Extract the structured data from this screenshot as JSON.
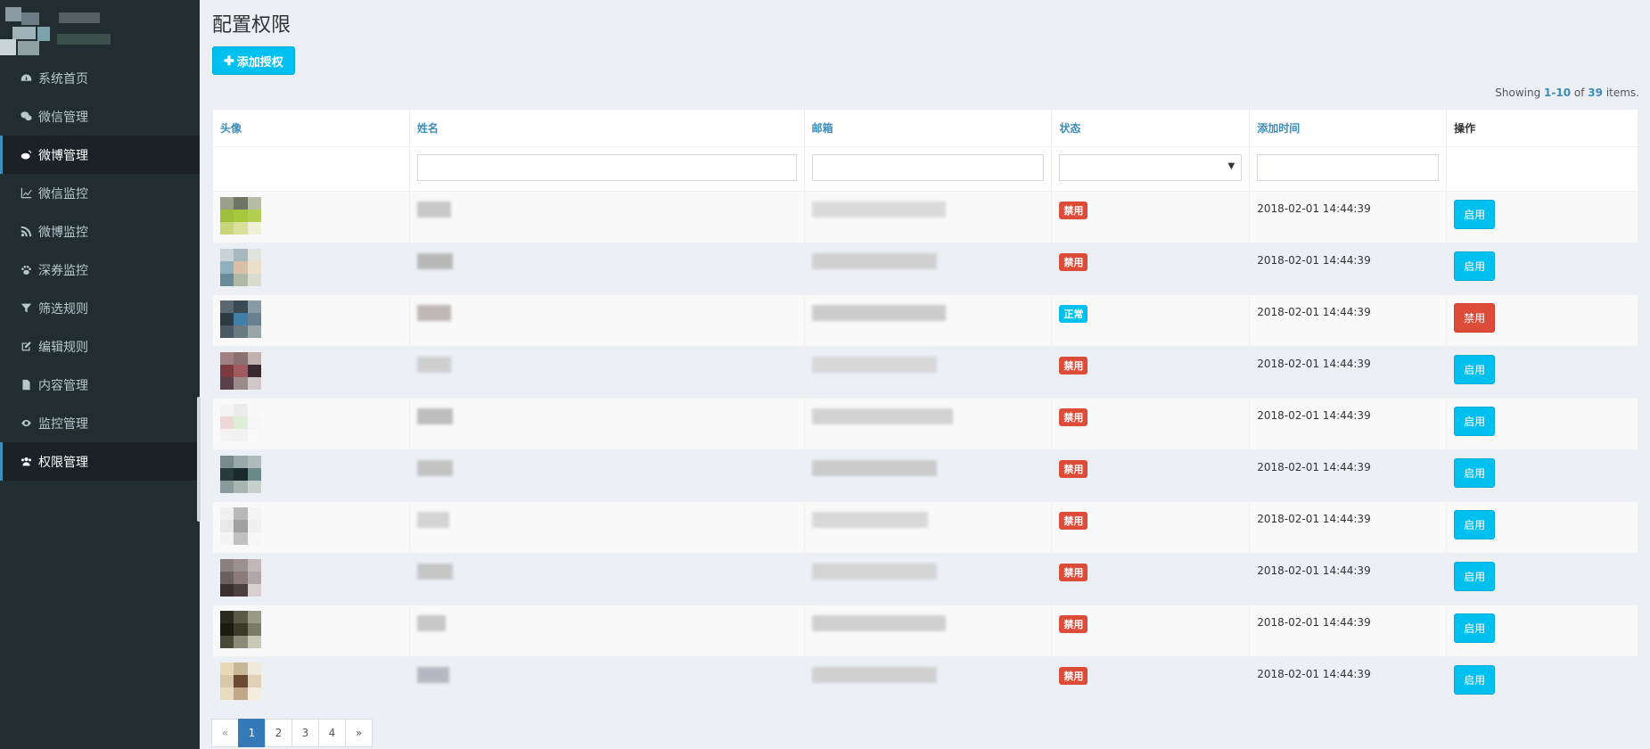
{
  "sidebar": {
    "items": [
      {
        "label": "系统首页",
        "icon": "dashboard-icon"
      },
      {
        "label": "微信管理",
        "icon": "wechat-icon"
      },
      {
        "label": "微博管理",
        "icon": "weibo-icon"
      },
      {
        "label": "微信监控",
        "icon": "line-chart-icon"
      },
      {
        "label": "微博监控",
        "icon": "rss-icon"
      },
      {
        "label": "深券监控",
        "icon": "paw-icon"
      },
      {
        "label": "筛选规则",
        "icon": "filter-icon"
      },
      {
        "label": "编辑规则",
        "icon": "edit-icon"
      },
      {
        "label": "内容管理",
        "icon": "file-icon"
      },
      {
        "label": "监控管理",
        "icon": "eye-icon"
      },
      {
        "label": "权限管理",
        "icon": "users-icon"
      }
    ]
  },
  "page": {
    "title": "配置权限",
    "add_button": "添加授权"
  },
  "summary": {
    "prefix": "Showing",
    "range": "1-10",
    "of": "of",
    "total": "39",
    "suffix": "items."
  },
  "table": {
    "headers": {
      "avatar": "头像",
      "name": "姓名",
      "email": "邮箱",
      "status": "状态",
      "added_time": "添加时间",
      "actions": "操作"
    },
    "rows": [
      {
        "status": "禁用",
        "added_time": "2018-02-01 14:44:39",
        "action": "启用"
      },
      {
        "status": "禁用",
        "added_time": "2018-02-01 14:44:39",
        "action": "启用"
      },
      {
        "status": "正常",
        "added_time": "2018-02-01 14:44:39",
        "action": "禁用"
      },
      {
        "status": "禁用",
        "added_time": "2018-02-01 14:44:39",
        "action": "启用"
      },
      {
        "status": "禁用",
        "added_time": "2018-02-01 14:44:39",
        "action": "启用"
      },
      {
        "status": "禁用",
        "added_time": "2018-02-01 14:44:39",
        "action": "启用"
      },
      {
        "status": "禁用",
        "added_time": "2018-02-01 14:44:39",
        "action": "启用"
      },
      {
        "status": "禁用",
        "added_time": "2018-02-01 14:44:39",
        "action": "启用"
      },
      {
        "status": "禁用",
        "added_time": "2018-02-01 14:44:39",
        "action": "启用"
      },
      {
        "status": "禁用",
        "added_time": "2018-02-01 14:44:39",
        "action": "启用"
      }
    ]
  },
  "pagination": {
    "prev": "«",
    "pages": [
      "1",
      "2",
      "3",
      "4"
    ],
    "next": "»",
    "current": "1"
  },
  "colors": {
    "sidebar_bg": "#222d32",
    "accent": "#00c0ef",
    "danger": "#dd4b39",
    "link": "#3c8dbc"
  }
}
